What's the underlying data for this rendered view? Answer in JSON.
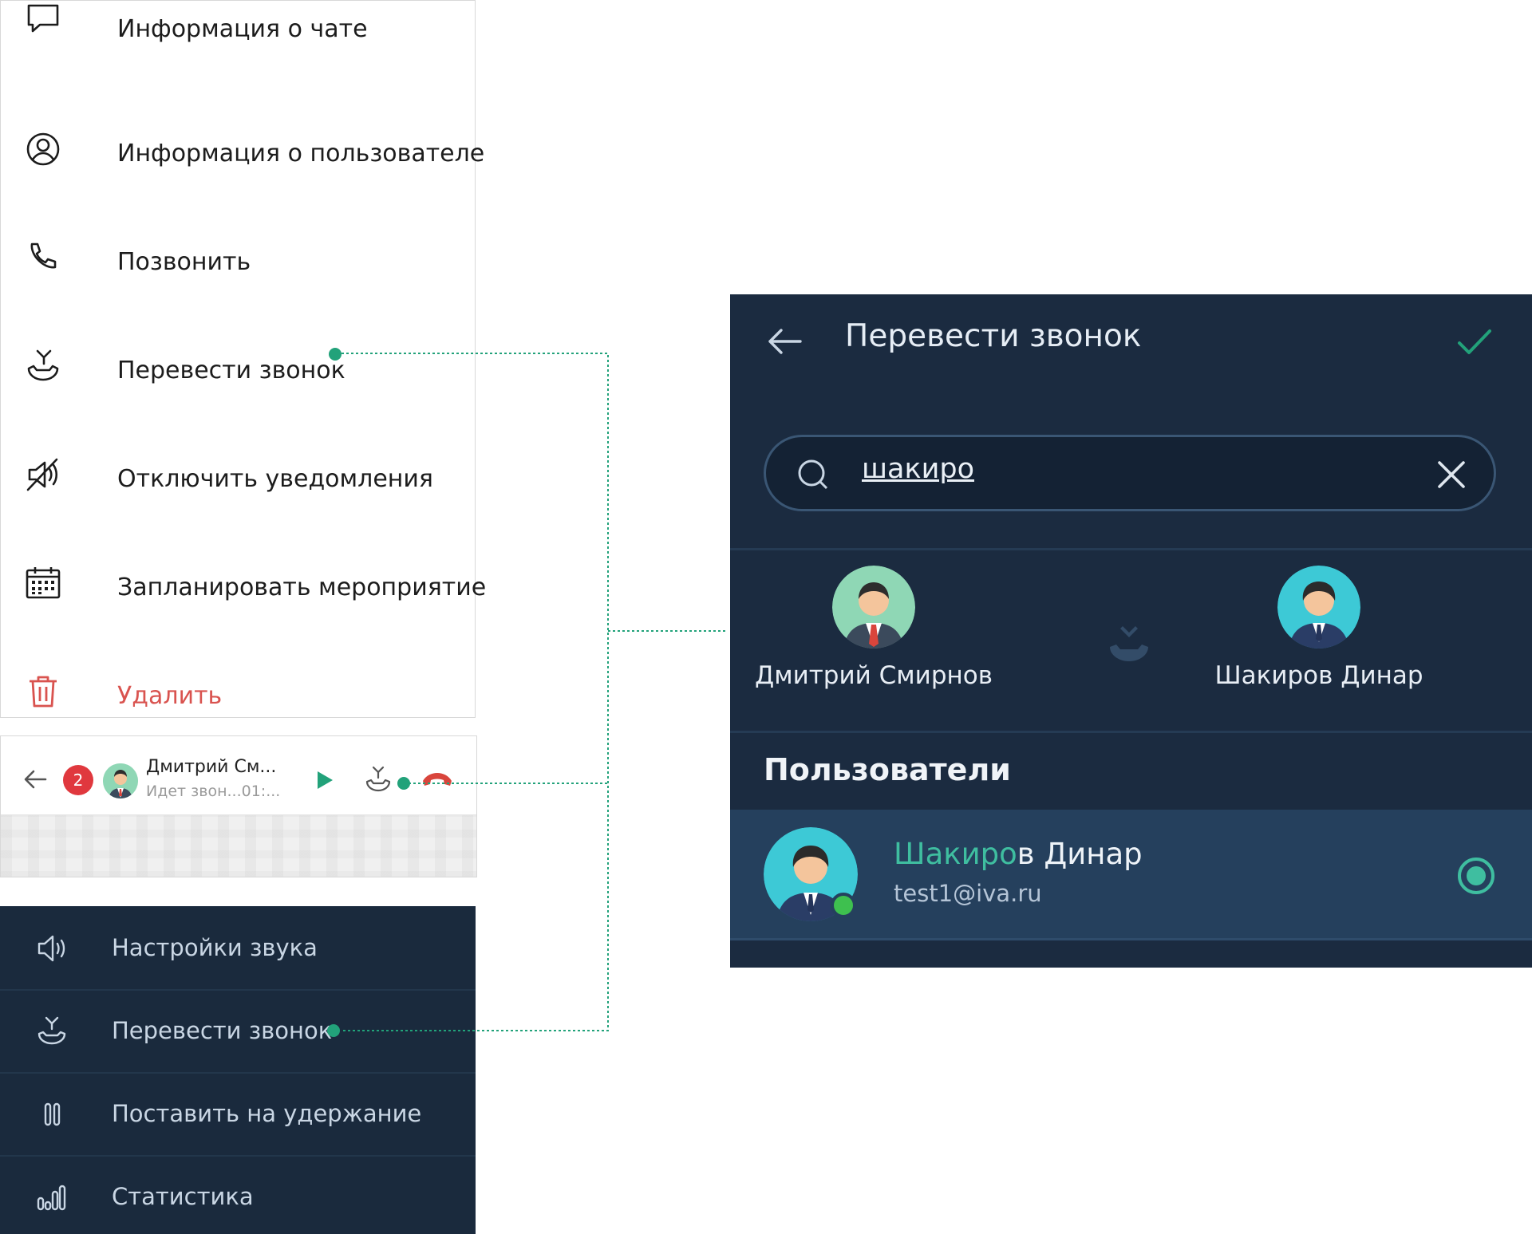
{
  "context_menu": {
    "items": [
      {
        "label": "Информация о чате",
        "icon": "chat-bubble-icon"
      },
      {
        "label": "Информация о пользователе",
        "icon": "user-circle-icon"
      },
      {
        "label": "Позвонить",
        "icon": "phone-icon"
      },
      {
        "label": "Перевести звонок",
        "icon": "call-transfer-icon"
      },
      {
        "label": "Отключить уведомления",
        "icon": "mute-icon"
      },
      {
        "label": "Запланировать мероприятие",
        "icon": "calendar-icon"
      },
      {
        "label": "Удалить",
        "icon": "trash-icon"
      }
    ]
  },
  "call_bar": {
    "badge": "2",
    "name": "Дмитрий См...",
    "status": "Идет звон...01:..."
  },
  "call_menu": {
    "items": [
      {
        "label": "Настройки звука",
        "icon": "speaker-icon"
      },
      {
        "label": "Перевести звонок",
        "icon": "call-transfer-icon"
      },
      {
        "label": "Поставить на удержание",
        "icon": "pause-icon"
      },
      {
        "label": "Статистика",
        "icon": "bar-chart-icon"
      }
    ]
  },
  "transfer_dialog": {
    "title": "Перевести звонок",
    "search_value": "шакиро",
    "from_party": "Дмитрий Смирнов",
    "to_party": "Шакиров Динар",
    "section_title": "Пользователи",
    "result": {
      "name_match": "Шакиро",
      "name_rest": "в Динар",
      "email": "test1@iva.ru"
    }
  },
  "colors": {
    "accent": "#22a27a",
    "danger": "#d9534f",
    "dark_bg": "#1b2b40",
    "highlight": "#3fbea0",
    "online": "#3ec04f"
  }
}
